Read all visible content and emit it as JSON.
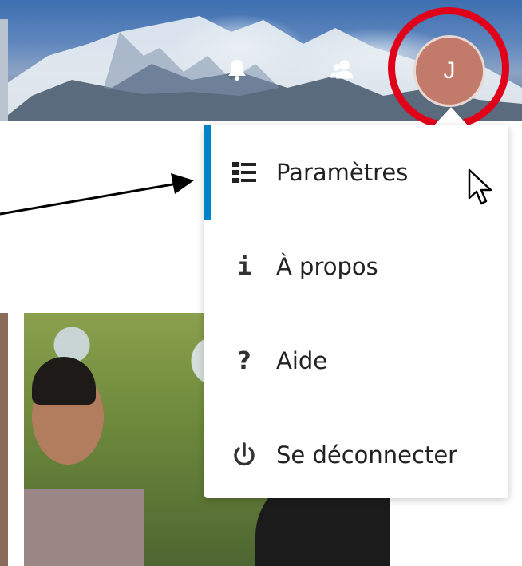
{
  "header": {
    "avatar_initial": "J",
    "icons": [
      "bell-icon",
      "contacts-icon"
    ]
  },
  "user_menu": {
    "items": [
      {
        "label": "Paramètres",
        "icon": "settings-list-icon",
        "active": true
      },
      {
        "label": "À propos",
        "icon": "info-icon"
      },
      {
        "label": "Aide",
        "icon": "help-icon"
      },
      {
        "label": "Se déconnecter",
        "icon": "power-icon"
      }
    ]
  },
  "colors": {
    "active_accent": "#0082c9",
    "avatar_bg": "#c27a6b",
    "highlight_circle": "#e0001a"
  }
}
